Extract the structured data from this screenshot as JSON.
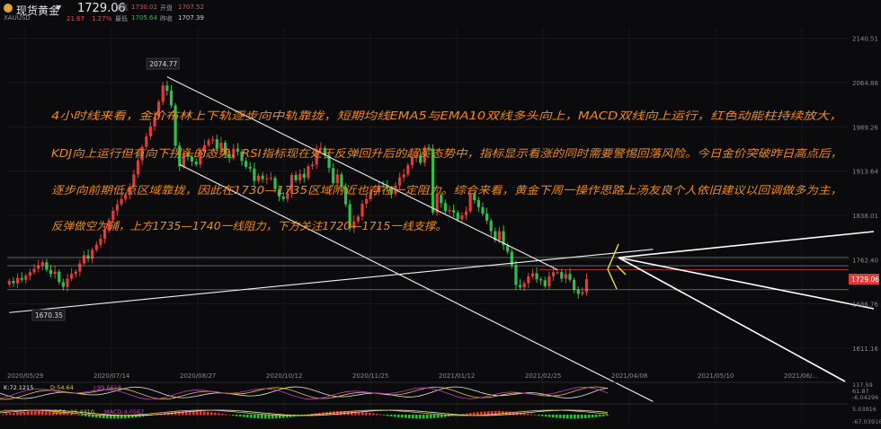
{
  "header": {
    "symbol_name": "现货黄金",
    "symbol_code": "XAUUSD",
    "last_price": "1729.06",
    "change": "21.67",
    "change_pct": "1.27%",
    "high_label": "最高",
    "high": "1730.02",
    "open_label": "开盘",
    "open": "1707.52",
    "low_label": "最低",
    "low": "1705.64",
    "prev_label": "昨收",
    "prev": "1707.39"
  },
  "colors": {
    "up": "#e03b3b",
    "down": "#2fbf4a",
    "annotation": "#f08a1a",
    "arrow_up": "#f5e633",
    "background": "#0b0b0d"
  },
  "chart_data": {
    "type": "candlestick",
    "symbol": "XAUUSD",
    "y_ticks": [
      2140.51,
      2064.88,
      1989.26,
      1913.64,
      1838.01,
      1762.4,
      1686.76,
      1611.16
    ],
    "x_ticks": [
      "2020/05/29",
      "2020/07/14",
      "2020/08/27",
      "2020/10/12",
      "2020/11/25",
      "2021/01/12",
      "2021/02/25",
      "2021/04/08",
      "2021/05/10",
      "2021/06/..."
    ],
    "ylim": [
      1585,
      2160
    ],
    "price_tag": 1729.06,
    "high_marker": 2074.77,
    "low_marker": 1670.35,
    "closes": [
      1726,
      1722,
      1731,
      1728,
      1735,
      1741,
      1747,
      1752,
      1758,
      1745,
      1738,
      1742,
      1724,
      1716,
      1730,
      1738,
      1742,
      1756,
      1770,
      1764,
      1779,
      1788,
      1798,
      1812,
      1830,
      1846,
      1857,
      1866,
      1873,
      1887,
      1908,
      1932,
      1955,
      1973,
      1990,
      2006,
      2032,
      2060,
      2051,
      2026,
      1957,
      1922,
      1944,
      1938,
      1930,
      1925,
      1946,
      1958,
      1966,
      1968,
      1952,
      1962,
      1943,
      1936,
      1952,
      1947,
      1931,
      1921,
      1918,
      1897,
      1906,
      1900,
      1901,
      1902,
      1883,
      1870,
      1866,
      1876,
      1907,
      1898,
      1909,
      1902,
      1922,
      1925,
      1951,
      1953,
      1941,
      1919,
      1893,
      1908,
      1887,
      1857,
      1816,
      1828,
      1836,
      1858,
      1866,
      1878,
      1880,
      1889,
      1888,
      1884,
      1875,
      1889,
      1903,
      1908,
      1924,
      1937,
      1941,
      1928,
      1954,
      1952,
      1843,
      1873,
      1859,
      1845,
      1847,
      1843,
      1831,
      1838,
      1845,
      1874,
      1864,
      1852,
      1841,
      1829,
      1811,
      1796,
      1811,
      1787,
      1776,
      1753,
      1719,
      1715,
      1722,
      1734,
      1739,
      1729,
      1727,
      1717,
      1734,
      1741,
      1741,
      1730,
      1738,
      1728,
      1711,
      1704,
      1707,
      1729
    ],
    "trendlines": [
      {
        "name": "upper-channel",
        "points": [
          [
            38,
            2074.77
          ],
          [
            132,
            1745
          ]
        ]
      },
      {
        "name": "lower-channel",
        "points": [
          [
            41,
            1925
          ],
          [
            155,
            1520
          ]
        ]
      },
      {
        "name": "support-rising",
        "points": [
          [
            0,
            1672
          ],
          [
            155,
            1780
          ]
        ]
      }
    ],
    "horizontal_levels": [
      1766,
      1752,
      1711
    ],
    "macd": {
      "K": "72.1215",
      "D": "54.64",
      "J": "99.6618",
      "DIF": "-14.4126",
      "DEA": "-16.4410",
      "MACD": "4.0567"
    },
    "indicator_axis": [
      "117.59",
      "61.87",
      "-6.04296",
      "5.03916",
      "-67.03916"
    ]
  },
  "annotation": {
    "line1": "4小时线来看，金价布林上下轨逐步向中轨靠拢，短期均线EMA5与EMA10双线多头向上，MACD双线向上运行，红色动能柱持续放大，",
    "line2": "KDJ向上运行但有向下拐头的态势，RSI指标现在处于反弹回升后的超买态势中，指标显示看涨的同时需要警惕回落风险。今日金价突破昨日高点后，",
    "line3": "逐步向前期低点区域靠拢，因此在1730—1735区域附近也存在一定阻力。综合来看，黄金下周一操作思路上汤友良个人依旧建议以回调做多为主，",
    "line4": "反弹做空为辅，上方1735—1740一线阻力，下方关注1720—1715一线支撑。"
  }
}
